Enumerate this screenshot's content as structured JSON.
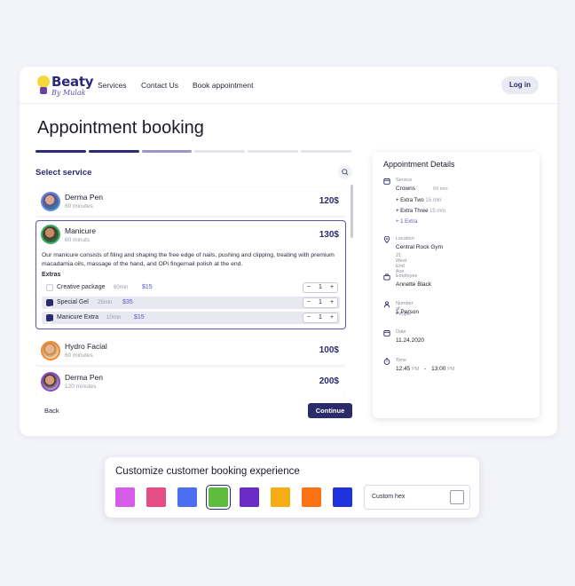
{
  "brand": {
    "title": "Beaty",
    "subtitle": "By Mulak"
  },
  "nav": {
    "links": [
      "Services",
      "Contact Us",
      "Book appointment"
    ],
    "login": "Log in"
  },
  "page": {
    "title": "Appointment booking",
    "progress_done": 2,
    "progress_active": 1,
    "progress_total": 6
  },
  "service_panel": {
    "heading": "Select service",
    "services": [
      {
        "name": "Derma Pen",
        "duration": "60 minutes",
        "price": "120$"
      },
      {
        "name": "Manicure",
        "duration": "60 minuts",
        "price": "130$",
        "description": "Our manicure consists of filing and shaping the free edge of nails, pushing and clipping, treating with premium macadamia oils, massage of the hand, and OPI fingernail polish at the end."
      },
      {
        "name": "Hydro Facial",
        "duration": "60 minutes",
        "price": "100$"
      },
      {
        "name": "Derma Pen",
        "duration": "120 minutes",
        "price": "200$"
      }
    ],
    "extras_heading": "Extras",
    "extras": [
      {
        "name": "Creative package",
        "duration": "60min",
        "price": "$15",
        "qty": "1",
        "checked": false
      },
      {
        "name": "Special Gel",
        "duration": "25min",
        "price": "$35",
        "qty": "1",
        "checked": true
      },
      {
        "name": "Manicure Extra",
        "duration": "10min",
        "price": "$15",
        "qty": "1",
        "checked": true
      }
    ],
    "back": "Back",
    "continue": "Continue"
  },
  "details": {
    "title": "Appointment Details",
    "service_label": "Service",
    "service_value": "Crowns",
    "service_duration": "60 min",
    "extra_items": [
      {
        "name": "Extra Two",
        "time": "15 min"
      },
      {
        "name": "Extra Three",
        "time": "15 min"
      }
    ],
    "extra_more": "1 Extra",
    "location_label": "Location",
    "location_value": "Central Rock Gym",
    "location_address": "21 West End Ave",
    "employee_label": "Employee",
    "employee_value": "Annette Black",
    "people_label": "Number of People",
    "people_value": "1 Person",
    "date_label": "Date",
    "date_value": "11.24.2020",
    "time_label": "Time",
    "time_start": "12:45",
    "time_start_ampm": "PM",
    "time_sep": "-",
    "time_end": "13:00",
    "time_end_ampm": "PM"
  },
  "customize": {
    "title": "Customize customer booking experience",
    "swatches": [
      "#d55ce6",
      "#e64d86",
      "#4c6ef0",
      "#5ebd3e",
      "#6b2bc6",
      "#f6ad15",
      "#f97316",
      "#1e32e0"
    ],
    "selected_index": 3,
    "custom_hex_label": "Custom hex"
  },
  "colors": {
    "primary": "#2b2a6b",
    "progress_done": "#2b2a78",
    "progress_active": "#9a97c8",
    "progress_todo": "#e3e4ec"
  }
}
